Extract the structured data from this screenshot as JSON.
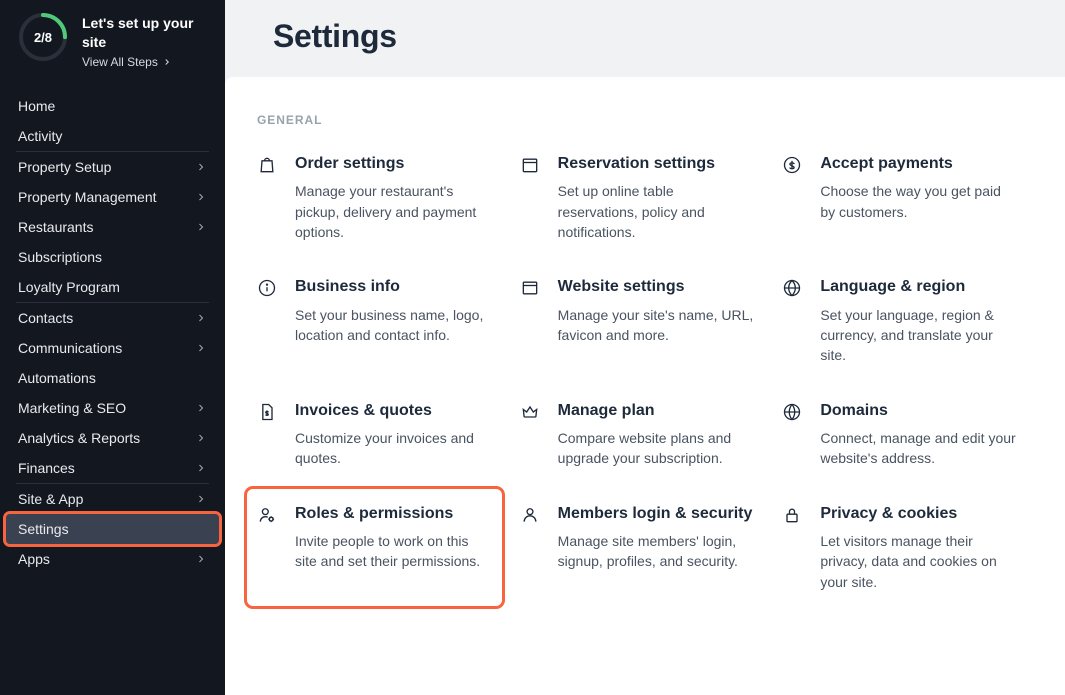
{
  "setup": {
    "progress_label": "2/8",
    "progress_value": 0.25,
    "title": "Let's set up your site",
    "link": "View All Steps"
  },
  "nav_groups": [
    {
      "items": [
        {
          "label": "Home",
          "chevron": false
        },
        {
          "label": "Activity",
          "chevron": false
        }
      ]
    },
    {
      "items": [
        {
          "label": "Property Setup",
          "chevron": true
        },
        {
          "label": "Property Management",
          "chevron": true
        },
        {
          "label": "Restaurants",
          "chevron": true
        },
        {
          "label": "Subscriptions",
          "chevron": false
        },
        {
          "label": "Loyalty Program",
          "chevron": false
        }
      ]
    },
    {
      "items": [
        {
          "label": "Contacts",
          "chevron": true
        },
        {
          "label": "Communications",
          "chevron": true
        },
        {
          "label": "Automations",
          "chevron": false
        },
        {
          "label": "Marketing & SEO",
          "chevron": true
        },
        {
          "label": "Analytics & Reports",
          "chevron": true
        },
        {
          "label": "Finances",
          "chevron": true
        }
      ]
    },
    {
      "items": [
        {
          "label": "Site & App",
          "chevron": true
        },
        {
          "label": "Settings",
          "chevron": false,
          "highlighted": true
        },
        {
          "label": "Apps",
          "chevron": true
        }
      ]
    }
  ],
  "page": {
    "title": "Settings",
    "section_label": "General"
  },
  "cards": [
    {
      "icon": "bag-icon",
      "title": "Order settings",
      "desc": "Manage your restaurant's pickup, delivery and payment options."
    },
    {
      "icon": "calendar-icon",
      "title": "Reservation settings",
      "desc": "Set up online table reservations, policy and notifications."
    },
    {
      "icon": "dollar-icon",
      "title": "Accept payments",
      "desc": "Choose the way you get paid by customers."
    },
    {
      "icon": "info-icon",
      "title": "Business info",
      "desc": "Set your business name, logo, location and contact info."
    },
    {
      "icon": "browser-icon",
      "title": "Website settings",
      "desc": "Manage your site's name, URL, favicon and more."
    },
    {
      "icon": "globe-icon",
      "title": "Language & region",
      "desc": "Set your language, region & currency, and translate your site."
    },
    {
      "icon": "file-dollar-icon",
      "title": "Invoices & quotes",
      "desc": "Customize your invoices and quotes."
    },
    {
      "icon": "crown-icon",
      "title": "Manage plan",
      "desc": "Compare website plans and upgrade your subscription."
    },
    {
      "icon": "world-icon",
      "title": "Domains",
      "desc": "Connect, manage and edit your website's address."
    },
    {
      "icon": "person-gear-icon",
      "title": "Roles & permissions",
      "desc": "Invite people to work on this site and set their permissions.",
      "highlighted": true
    },
    {
      "icon": "person-icon",
      "title": "Members login & security",
      "desc": "Manage site members' login, signup, profiles, and security."
    },
    {
      "icon": "lock-icon",
      "title": "Privacy & cookies",
      "desc": "Let visitors manage their privacy, data and cookies on your site."
    }
  ]
}
